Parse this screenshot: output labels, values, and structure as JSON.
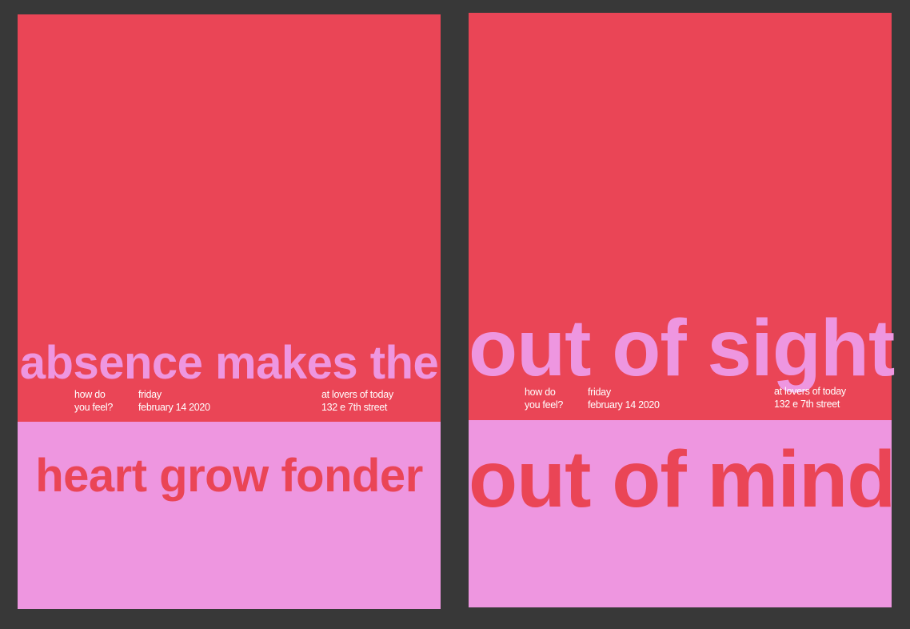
{
  "colors": {
    "background": "#383838",
    "red": "#ea4556",
    "pink": "#ee96e0",
    "white": "#ffffff"
  },
  "posters": [
    {
      "headline_top": "absence makes the",
      "headline_bottom": "heart grow fonder",
      "question": [
        "how do",
        "you feel?"
      ],
      "date": [
        "friday",
        "february 14 2020"
      ],
      "location": [
        "at lovers of today",
        "132 e 7th street"
      ]
    },
    {
      "headline_top": "out of sight",
      "headline_bottom": "out of mind",
      "question": [
        "how do",
        "you feel?"
      ],
      "date": [
        "friday",
        "february 14 2020"
      ],
      "location": [
        "at lovers of today",
        "132 e 7th street"
      ]
    }
  ]
}
